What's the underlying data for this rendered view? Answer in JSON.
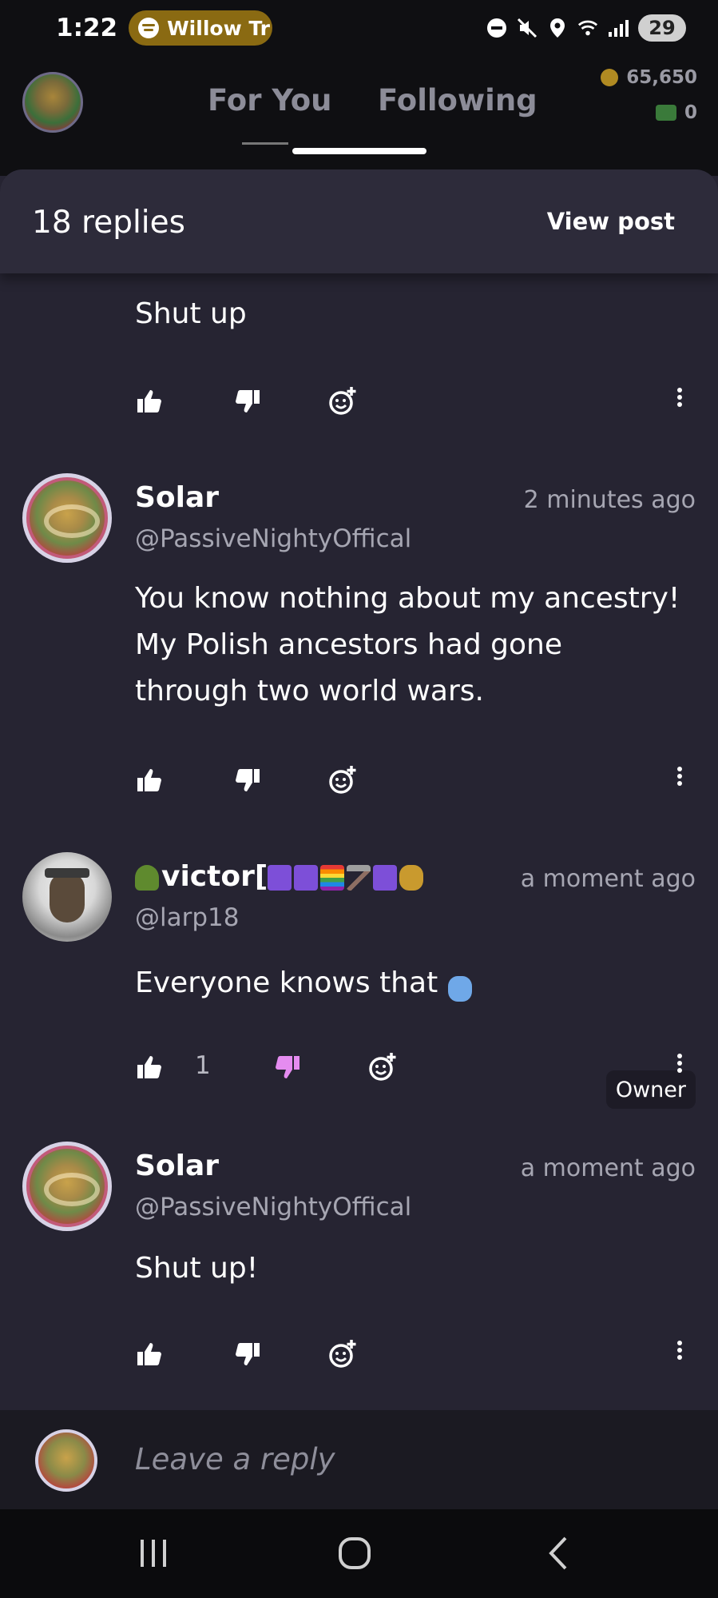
{
  "status_bar": {
    "time": "1:22",
    "media_pill": "Willow Tr",
    "battery": "29"
  },
  "header": {
    "tabs": [
      "For You",
      "Following"
    ],
    "coins": "65,650",
    "cash": "0"
  },
  "sheet": {
    "replies_count": "18 replies",
    "view_post": "View post"
  },
  "comments": [
    {
      "text": "Shut up"
    },
    {
      "name": "Solar",
      "handle": "@PassiveNightyOffical",
      "time": "2 minutes ago",
      "text_lines": [
        "You know nothing about my ancestry!",
        "My Polish ancestors had gone",
        "through two world wars."
      ]
    },
    {
      "name_text": "victor[",
      "handle": "@larp18",
      "time": "a moment ago",
      "badge": "Owner",
      "text": "Everyone knows that",
      "like_count": "1"
    },
    {
      "name": "Solar",
      "handle": "@PassiveNightyOffical",
      "time": "a moment ago",
      "text": "Shut up!"
    }
  ],
  "reply_bar": {
    "placeholder": "Leave a reply"
  },
  "colors": {
    "background": "#262432",
    "sheet_header": "#2d2b3a",
    "disliked": "#e58cf0",
    "muted_text": "#a6a6b2"
  }
}
